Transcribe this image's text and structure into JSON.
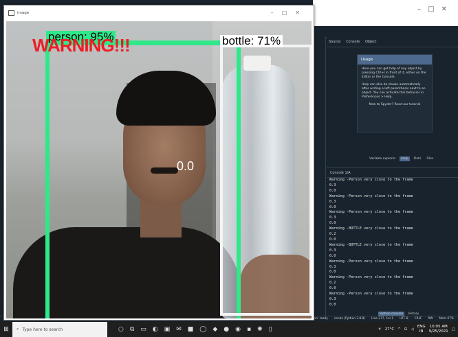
{
  "image_window": {
    "title": "image",
    "detections": {
      "person_label": "person: 95%",
      "bottle_label": "bottle: 71%",
      "warning_text": "WARNING!!!",
      "distance_text": "0.0"
    },
    "colors": {
      "person_box": "#2ee88a",
      "bottle_box": "#f4f4f4",
      "warning": "#ee1c24"
    }
  },
  "spyder": {
    "help_tabs": [
      "Source",
      "Console",
      "Object"
    ],
    "usage": {
      "title": "Usage",
      "body1": "Here you can get help of any object by pressing Ctrl+I in front of it, either on the Editor or the Console.",
      "body2": "Help can also be shown automatically after writing a left parenthesis next to an object. You can activate this behavior in Preferences > Help.",
      "body3": "New to Spyder? Read our tutorial"
    },
    "pane_tabs": [
      "Variable explorer",
      "Help",
      "Plots",
      "Files"
    ],
    "console_tab": "Console 1/A",
    "console_lines": [
      "Warning -Person very close to the frame",
      "0.3",
      "0.0",
      "Warning -Person very close to the frame",
      "0.3",
      "0.0",
      "Warning -Person very close to the frame",
      "0.3",
      "0.0",
      "Warning -BOTTLE very close to the frame",
      "0.2",
      "0.0",
      "Warning -BOTTLE very close to the frame",
      "0.3",
      "0.0",
      "Warning -Person very close to the frame",
      "0.3",
      "0.0",
      "Warning -Person very close to the frame",
      "0.2",
      "0.0",
      "Warning -Person very close to the frame",
      "0.3",
      "0.0"
    ],
    "console_bottom_tabs": [
      "Python console",
      "History"
    ],
    "status": [
      "LSP Python: ready",
      "conda (Python 3.8.8)",
      "Line 277, Col 1",
      "UTF-8",
      "CRLF",
      "RW",
      "Mem 67%"
    ]
  },
  "taskbar": {
    "search_placeholder": "Type here to search",
    "weather": "27°C",
    "lang": "ENG",
    "region": "IN",
    "time": "10:05 AM",
    "date": "9/25/2021"
  }
}
